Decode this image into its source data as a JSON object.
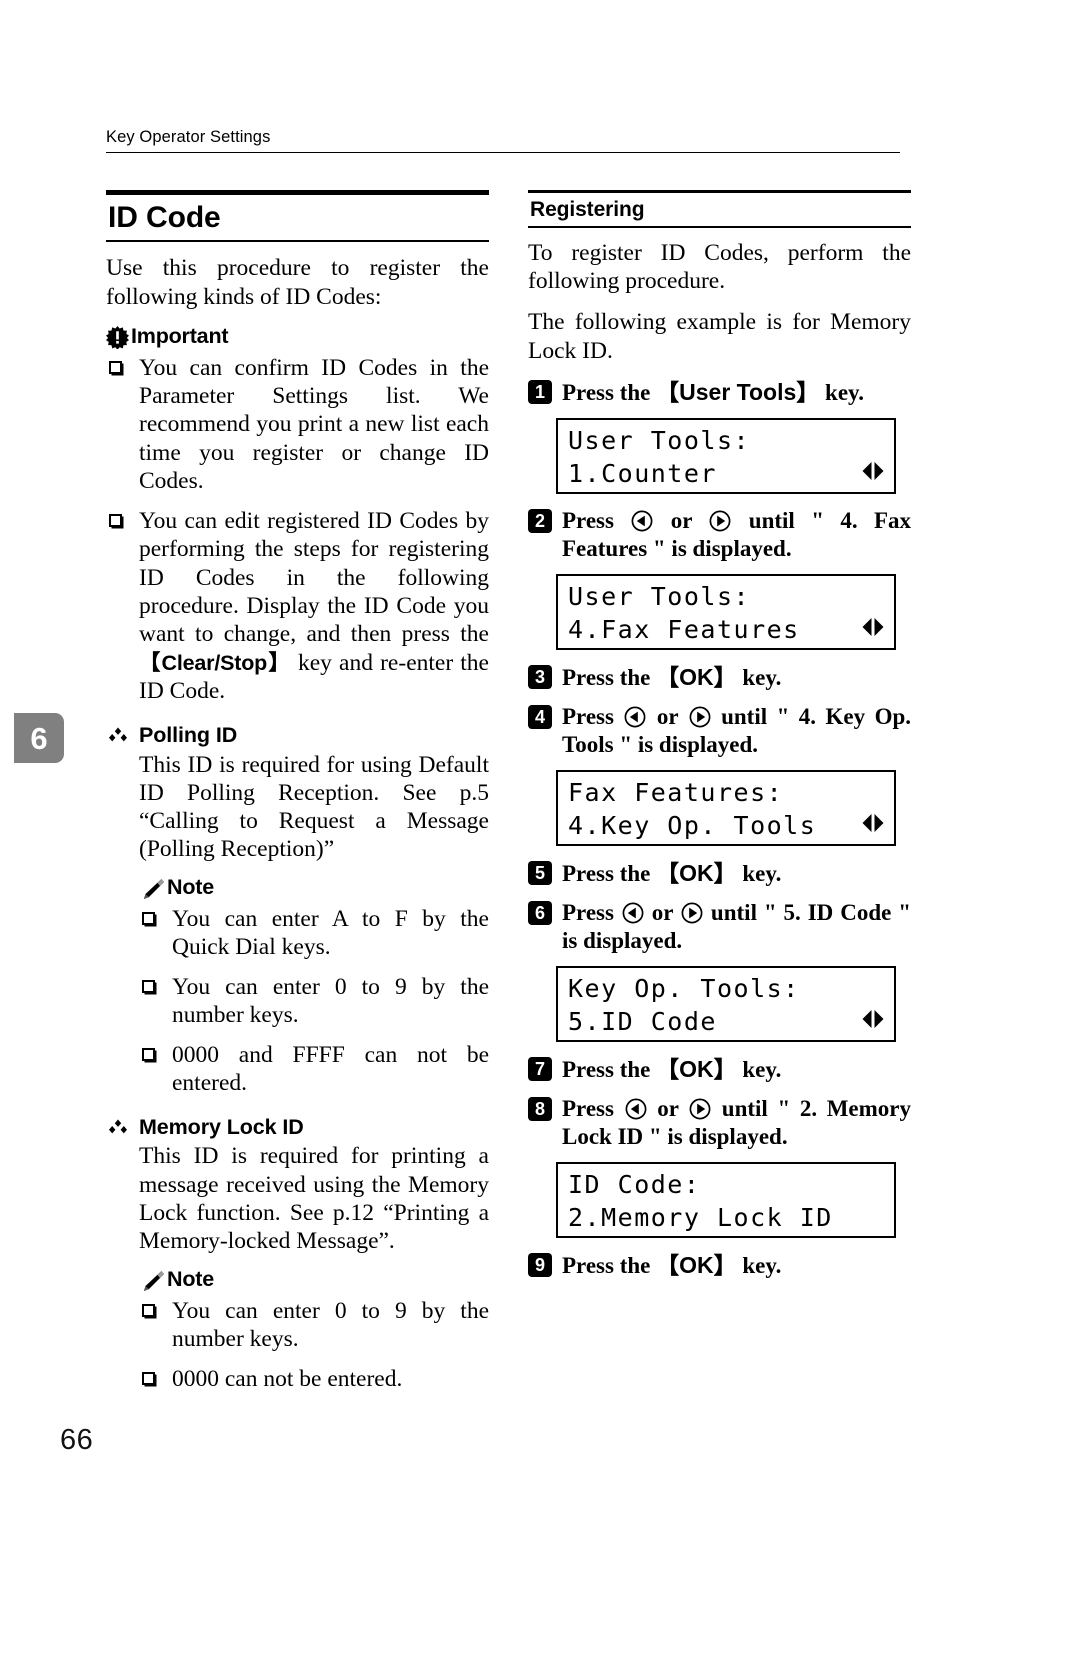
{
  "document": {
    "running_header": "Key Operator Settings",
    "chapter_marker": "6",
    "page_number": "66"
  },
  "left_column": {
    "title": "ID Code",
    "intro": "Use this procedure to register the following kinds of ID Codes:",
    "important": {
      "icon": "important-starburst-icon",
      "label": "Important",
      "items": [
        "You can confirm ID Codes in the Parameter Settings list. We recommend you print a new list each time you register or change ID Codes.",
        "You can edit registered ID Codes by performing the steps for registering ID Codes in the following procedure. Display the ID Code you want to change, and then press the "
      ],
      "item2_key": "【Clear/Stop】",
      "item2_tail": " key and re-enter the ID Code."
    },
    "sections": [
      {
        "icon": "diamond-bullet-icon",
        "heading": "Polling ID",
        "body": "This ID is required for using Default ID Polling Reception. See p.5 “Calling to Request a Message (Polling Reception)”",
        "note": {
          "icon": "note-pencil-icon",
          "label": "Note",
          "items": [
            "You can enter A to F by the Quick Dial keys.",
            "You can enter 0 to 9 by the number keys.",
            "0000 and FFFF can not be entered."
          ]
        }
      },
      {
        "icon": "diamond-bullet-icon",
        "heading": "Memory Lock ID",
        "body": "This ID is required for printing a message received using the Memory Lock function. See  p.12 “Printing a Memory-locked Message”.",
        "note": {
          "icon": "note-pencil-icon",
          "label": "Note",
          "items": [
            "You can enter 0 to 9 by the number keys.",
            "0000 can not be entered."
          ]
        }
      }
    ]
  },
  "right_column": {
    "title": "Registering",
    "intro1": "To register ID Codes, perform the following procedure.",
    "intro2": "The following example is for Memory Lock ID.",
    "steps": [
      {
        "num": "1",
        "text_before": "Press the ",
        "key": "【User Tools】",
        "text_after": " key.",
        "lcd": {
          "line1": "User Tools:",
          "line2": "1.Counter",
          "scroll_icon": "left-right-arrows-icon"
        }
      },
      {
        "num": "2",
        "text_before": "Press ",
        "arrow_left": "left-arrow-button-icon",
        "text_mid": " or ",
        "arrow_right": "right-arrow-button-icon",
        "text_after": " until \" 4. Fax Features \" is displayed.",
        "lcd": {
          "line1": "User Tools:",
          "line2": "4.Fax Features",
          "scroll_icon": "left-right-arrows-icon"
        }
      },
      {
        "num": "3",
        "text_before": "Press the ",
        "key": "【OK】",
        "text_after": " key.",
        "lcd": null
      },
      {
        "num": "4",
        "text_before": "Press ",
        "arrow_left": "left-arrow-button-icon",
        "text_mid": " or ",
        "arrow_right": "right-arrow-button-icon",
        "text_after": " until \" 4. Key Op. Tools \" is displayed.",
        "lcd": {
          "line1": "Fax Features:",
          "line2": "4.Key Op. Tools",
          "scroll_icon": "left-right-arrows-icon"
        }
      },
      {
        "num": "5",
        "text_before": "Press the ",
        "key": "【OK】",
        "text_after": " key.",
        "lcd": null
      },
      {
        "num": "6",
        "text_before": "Press ",
        "arrow_left": "left-arrow-button-icon",
        "text_mid": " or ",
        "arrow_right": "right-arrow-button-icon",
        "text_after": " until \" 5. ID Code \" is displayed.",
        "lcd": {
          "line1": "Key Op. Tools:",
          "line2": "5.ID Code",
          "scroll_icon": "left-right-arrows-icon"
        }
      },
      {
        "num": "7",
        "text_before": "Press the ",
        "key": "【OK】",
        "text_after": " key.",
        "lcd": null
      },
      {
        "num": "8",
        "text_before": "Press ",
        "arrow_left": "left-arrow-button-icon",
        "text_mid": " or ",
        "arrow_right": "right-arrow-button-icon",
        "text_after": " until \" 2. Memory Lock ID \" is displayed.",
        "lcd": {
          "line1": "ID Code:",
          "line2": "2.Memory Lock ID",
          "scroll_icon": "left-right-arrows-icon"
        }
      },
      {
        "num": "9",
        "text_before": "Press the ",
        "key": "【OK】",
        "text_after": " key.",
        "lcd": null
      }
    ]
  },
  "colors": {
    "ink": "#000000",
    "chapter_tab_bg": "#808080"
  }
}
